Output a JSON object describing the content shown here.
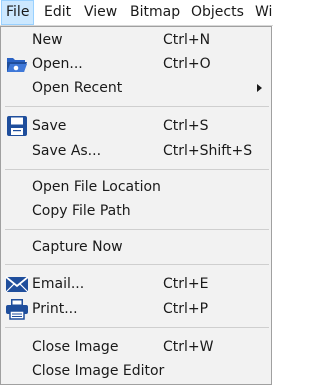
{
  "menubar": {
    "items": [
      {
        "id": "file",
        "label": "File"
      },
      {
        "id": "edit",
        "label": "Edit"
      },
      {
        "id": "view",
        "label": "View"
      },
      {
        "id": "bitmap",
        "label": "Bitmap"
      },
      {
        "id": "objects",
        "label": "Objects"
      },
      {
        "id": "window",
        "label": "Wi"
      }
    ]
  },
  "file_menu": {
    "new": {
      "label": "New",
      "shortcut": "Ctrl+N"
    },
    "open": {
      "label": "Open...",
      "shortcut": "Ctrl+O",
      "icon": "folder-open-icon"
    },
    "open_recent": {
      "label": "Open Recent",
      "submenu": true
    },
    "save": {
      "label": "Save",
      "shortcut": "Ctrl+S",
      "icon": "floppy-disk-icon"
    },
    "save_as": {
      "label": "Save As...",
      "shortcut": "Ctrl+Shift+S"
    },
    "open_location": {
      "label": "Open File Location"
    },
    "copy_path": {
      "label": "Copy File Path"
    },
    "capture": {
      "label": "Capture Now"
    },
    "email": {
      "label": "Email...",
      "shortcut": "Ctrl+E",
      "icon": "envelope-icon"
    },
    "print": {
      "label": "Print...",
      "shortcut": "Ctrl+P",
      "icon": "printer-icon"
    },
    "close_image": {
      "label": "Close Image",
      "shortcut": "Ctrl+W"
    },
    "close_editor": {
      "label": "Close Image Editor"
    }
  },
  "colors": {
    "accent": "#cce8ff",
    "icon_blue": "#1f4e9c"
  }
}
